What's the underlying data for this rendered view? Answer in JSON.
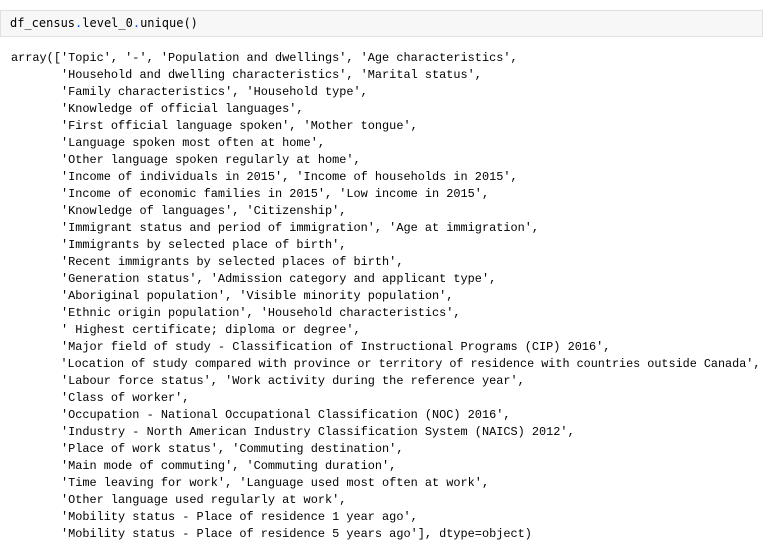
{
  "input_cell": {
    "object": "df_census",
    "dot1": ".",
    "attribute": "level_0",
    "dot2": ".",
    "method": "unique",
    "call": "()"
  },
  "output": {
    "lines": [
      "array(['Topic', '-', 'Population and dwellings', 'Age characteristics',",
      "       'Household and dwelling characteristics', 'Marital status',",
      "       'Family characteristics', 'Household type',",
      "       'Knowledge of official languages',",
      "       'First official language spoken', 'Mother tongue',",
      "       'Language spoken most often at home',",
      "       'Other language spoken regularly at home',",
      "       'Income of individuals in 2015', 'Income of households in 2015',",
      "       'Income of economic families in 2015', 'Low income in 2015',",
      "       'Knowledge of languages', 'Citizenship',",
      "       'Immigrant status and period of immigration', 'Age at immigration',",
      "       'Immigrants by selected place of birth',",
      "       'Recent immigrants by selected places of birth',",
      "       'Generation status', 'Admission category and applicant type',",
      "       'Aboriginal population', 'Visible minority population',",
      "       'Ethnic origin population', 'Household characteristics',",
      "       ' Highest certificate; diploma or degree',",
      "       'Major field of study - Classification of Instructional Programs (CIP) 2016',",
      "       'Location of study compared with province or territory of residence with countries outside Canada',",
      "       'Labour force status', 'Work activity during the reference year',",
      "       'Class of worker',",
      "       'Occupation - National Occupational Classification (NOC) 2016',",
      "       'Industry - North American Industry Classification System (NAICS) 2012',",
      "       'Place of work status', 'Commuting destination',",
      "       'Main mode of commuting', 'Commuting duration',",
      "       'Time leaving for work', 'Language used most often at work',",
      "       'Other language used regularly at work',",
      "       'Mobility status - Place of residence 1 year ago',",
      "       'Mobility status - Place of residence 5 years ago'], dtype=object)"
    ]
  }
}
